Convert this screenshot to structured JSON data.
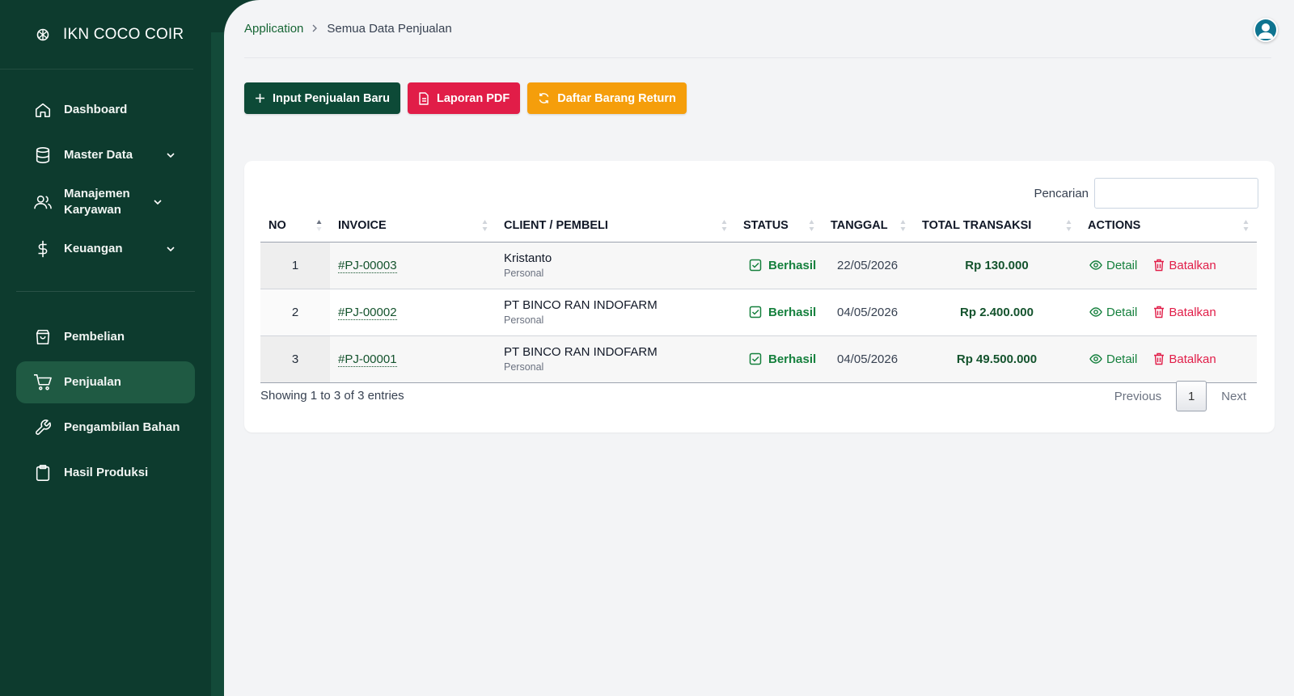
{
  "brand": {
    "name": "IKN COCO COIR"
  },
  "sidebar": {
    "items": [
      {
        "label": "Dashboard",
        "icon": "home-icon"
      },
      {
        "label": "Master Data",
        "icon": "database-icon"
      },
      {
        "label": "Manajemen Karyawan",
        "icon": "users-icon"
      },
      {
        "label": "Keuangan",
        "icon": "dollar-icon"
      },
      {
        "label": "Pembelian",
        "icon": "shopping-bag-icon"
      },
      {
        "label": "Penjualan",
        "icon": "cart-icon"
      },
      {
        "label": "Pengambilan Bahan",
        "icon": "wrench-icon"
      },
      {
        "label": "Hasil Produksi",
        "icon": "clipboard-icon"
      }
    ]
  },
  "breadcrumb": {
    "parent": "Application",
    "current": "Semua Data Penjualan"
  },
  "toolbar": {
    "new_label": "Input Penjualan Baru",
    "pdf_label": "Laporan PDF",
    "return_label": "Daftar Barang Return"
  },
  "search": {
    "label": "Pencarian",
    "value": ""
  },
  "table": {
    "columns": [
      "NO",
      "INVOICE",
      "CLIENT / PEMBELI",
      "STATUS",
      "TANGGAL",
      "TOTAL TRANSAKSI",
      "ACTIONS"
    ],
    "rows": [
      {
        "no": "1",
        "invoice": "#PJ-00003",
        "client": "Kristanto",
        "client_type": "Personal",
        "status": "Berhasil",
        "date": "22/05/2026",
        "total": "Rp 130.000",
        "detail": "Detail",
        "cancel": "Batalkan"
      },
      {
        "no": "2",
        "invoice": "#PJ-00002",
        "client": "PT BINCO RAN INDOFARM",
        "client_type": "Personal",
        "status": "Berhasil",
        "date": "04/05/2026",
        "total": "Rp 2.400.000",
        "detail": "Detail",
        "cancel": "Batalkan"
      },
      {
        "no": "3",
        "invoice": "#PJ-00001",
        "client": "PT BINCO RAN INDOFARM",
        "client_type": "Personal",
        "status": "Berhasil",
        "date": "04/05/2026",
        "total": "Rp 49.500.000",
        "detail": "Detail",
        "cancel": "Batalkan"
      }
    ]
  },
  "footer": {
    "info": "Showing 1 to 3 of 3 entries",
    "previous": "Previous",
    "page": "1",
    "next": "Next"
  },
  "colors": {
    "sidebar": "#0d3b2e",
    "primary": "#0d4a37",
    "danger": "#e11d48",
    "warning": "#f59e0b",
    "success": "#15803d"
  }
}
